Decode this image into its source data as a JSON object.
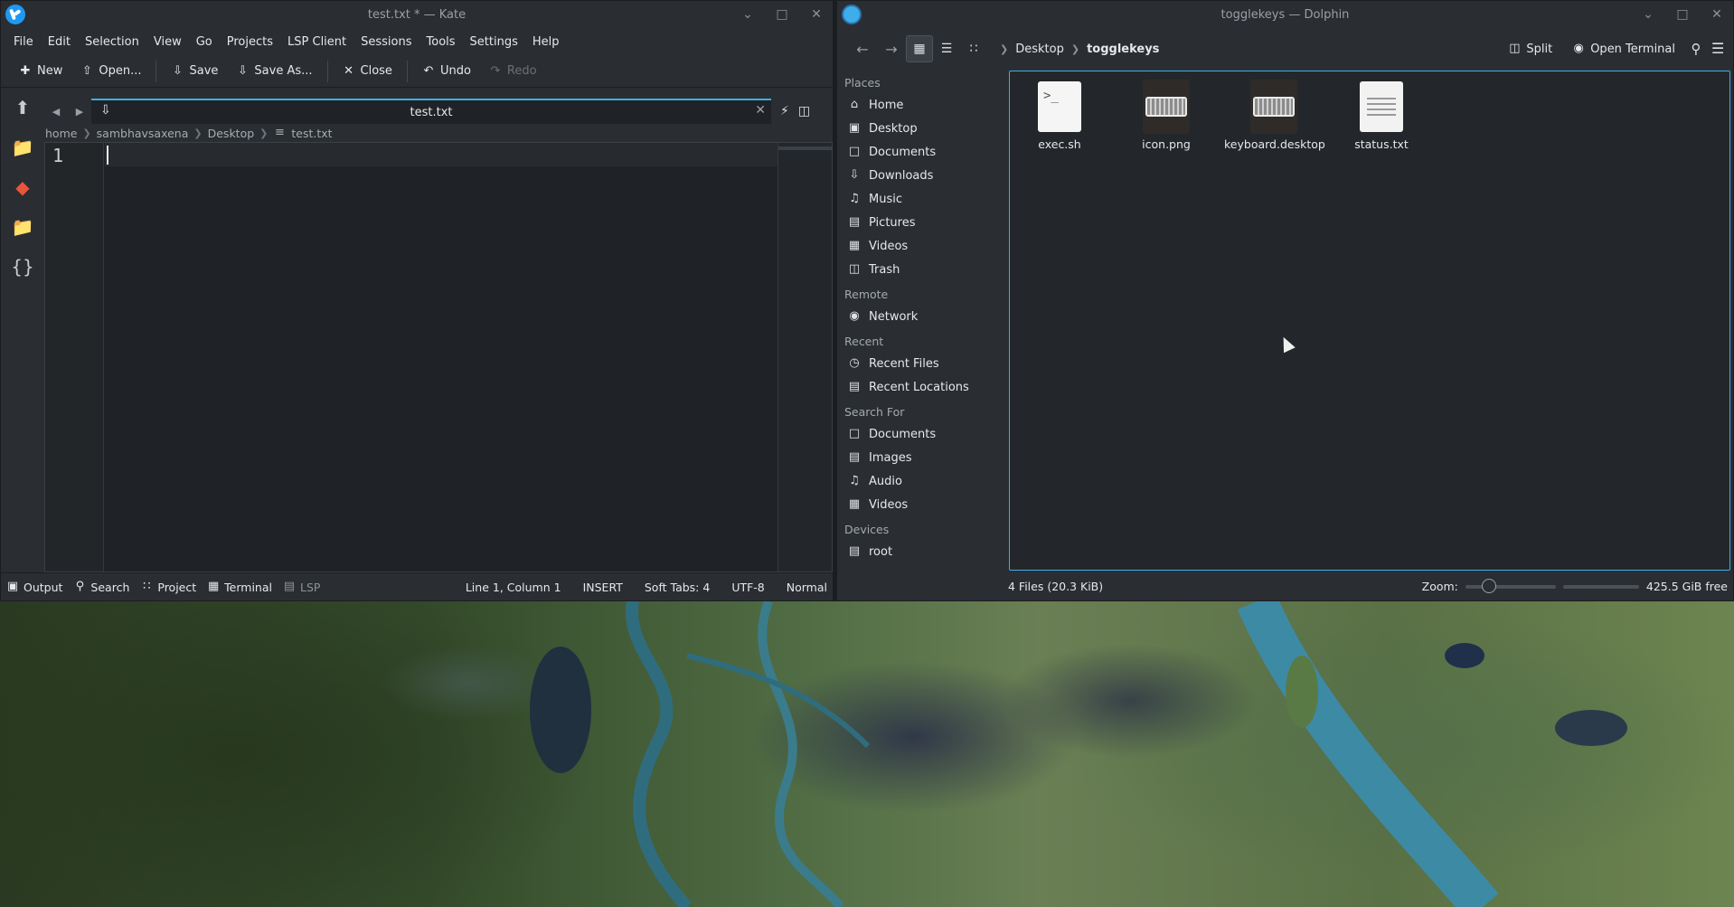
{
  "kate": {
    "title": "test.txt * — Kate",
    "menu": [
      "File",
      "Edit",
      "Selection",
      "View",
      "Go",
      "Projects",
      "LSP Client",
      "Sessions",
      "Tools",
      "Settings",
      "Help"
    ],
    "toolbar": {
      "new": "New",
      "open": "Open...",
      "save": "Save",
      "save_as": "Save As...",
      "close": "Close",
      "undo": "Undo",
      "redo": "Redo"
    },
    "tab": {
      "label": "test.txt"
    },
    "breadcrumb": [
      "home",
      "sambhavsaxena",
      "Desktop",
      "test.txt"
    ],
    "editor": {
      "line_number": "1"
    },
    "statusbar": {
      "output": "Output",
      "search": "Search",
      "project": "Project",
      "terminal": "Terminal",
      "lsp": "LSP",
      "position": "Line 1, Column 1",
      "mode": "INSERT",
      "indent": "Soft Tabs: 4",
      "encoding": "UTF-8",
      "input_mode": "Normal"
    }
  },
  "dolphin": {
    "title": "togglekeys — Dolphin",
    "breadcrumb": {
      "parent": "Desktop",
      "current": "togglekeys"
    },
    "toolbar": {
      "split": "Split",
      "open_terminal": "Open Terminal"
    },
    "places": {
      "places_header": "Places",
      "places_items": [
        "Home",
        "Desktop",
        "Documents",
        "Downloads",
        "Music",
        "Pictures",
        "Videos",
        "Trash"
      ],
      "remote_header": "Remote",
      "remote_items": [
        "Network"
      ],
      "recent_header": "Recent",
      "recent_items": [
        "Recent Files",
        "Recent Locations"
      ],
      "search_header": "Search For",
      "search_items": [
        "Documents",
        "Images",
        "Audio",
        "Videos"
      ],
      "devices_header": "Devices",
      "devices_items": [
        "root"
      ]
    },
    "files": [
      {
        "name": "exec.sh",
        "type": "script"
      },
      {
        "name": "icon.png",
        "type": "image"
      },
      {
        "name": "keyboard.desktop",
        "type": "image"
      },
      {
        "name": "status.txt",
        "type": "text"
      }
    ],
    "status": {
      "summary": "4 Files (20.3 KiB)",
      "zoom_label": "Zoom:",
      "free_space": "425.5 GiB free"
    }
  }
}
